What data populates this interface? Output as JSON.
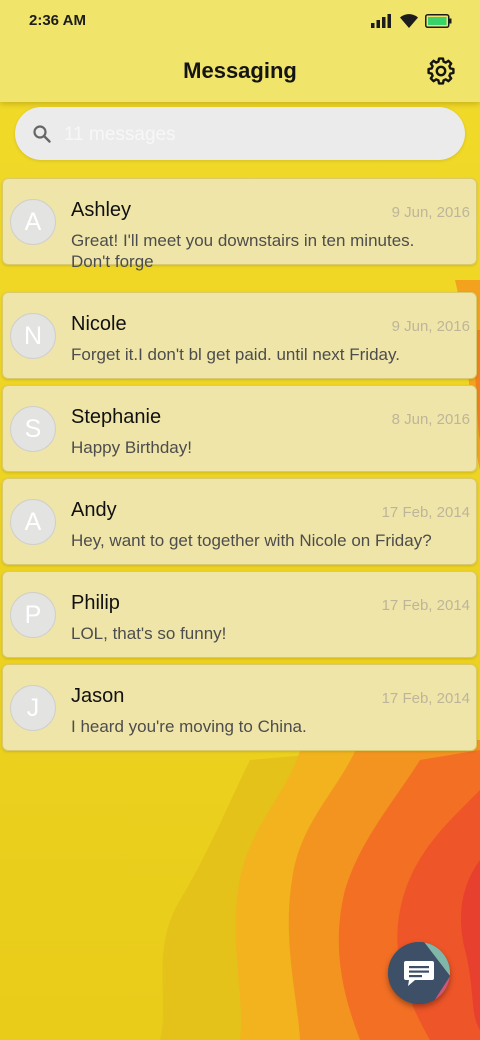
{
  "status_bar": {
    "time": "2:36 AM",
    "icons": [
      "signal-icon",
      "wifi-icon",
      "battery-icon"
    ]
  },
  "header": {
    "title": "Messaging",
    "settings_icon": "gear-icon"
  },
  "search": {
    "placeholder": "11 messages",
    "icon": "search-icon"
  },
  "conversations": [
    {
      "initial": "A",
      "name": "Ashley",
      "date": "9 Jun, 2016",
      "preview_lines": [
        "Great! I'll meet you downstairs in ten minutes.",
        "Don't forge"
      ]
    },
    {
      "initial": "N",
      "name": "Nicole",
      "date": "9 Jun, 2016",
      "preview_lines": [
        "Forget it.I don't bl get paid. until next Friday."
      ]
    },
    {
      "initial": "S",
      "name": "Stephanie",
      "date": "8 Jun, 2016",
      "preview_lines": [
        "Happy Birthday!"
      ]
    },
    {
      "initial": "A",
      "name": "Andy",
      "date": "17 Feb, 2014",
      "preview_lines": [
        "Hey, want to get together with Nicole on Friday?"
      ]
    },
    {
      "initial": "P",
      "name": "Philip",
      "date": "17 Feb, 2014",
      "preview_lines": [
        "LOL, that's so funny!"
      ]
    },
    {
      "initial": "J",
      "name": "Jason",
      "date": "17 Feb, 2014",
      "preview_lines": [
        "I heard you're moving to China."
      ]
    }
  ],
  "fab": {
    "icon": "compose-message-icon"
  },
  "colors": {
    "appbar": "#f0e46a",
    "card": "#efe5a8",
    "wallpaper_yellow": "#ecd21f",
    "wallpaper_orange": "#f08a1a",
    "wallpaper_red": "#e8402e",
    "fab": "#3d5068"
  }
}
